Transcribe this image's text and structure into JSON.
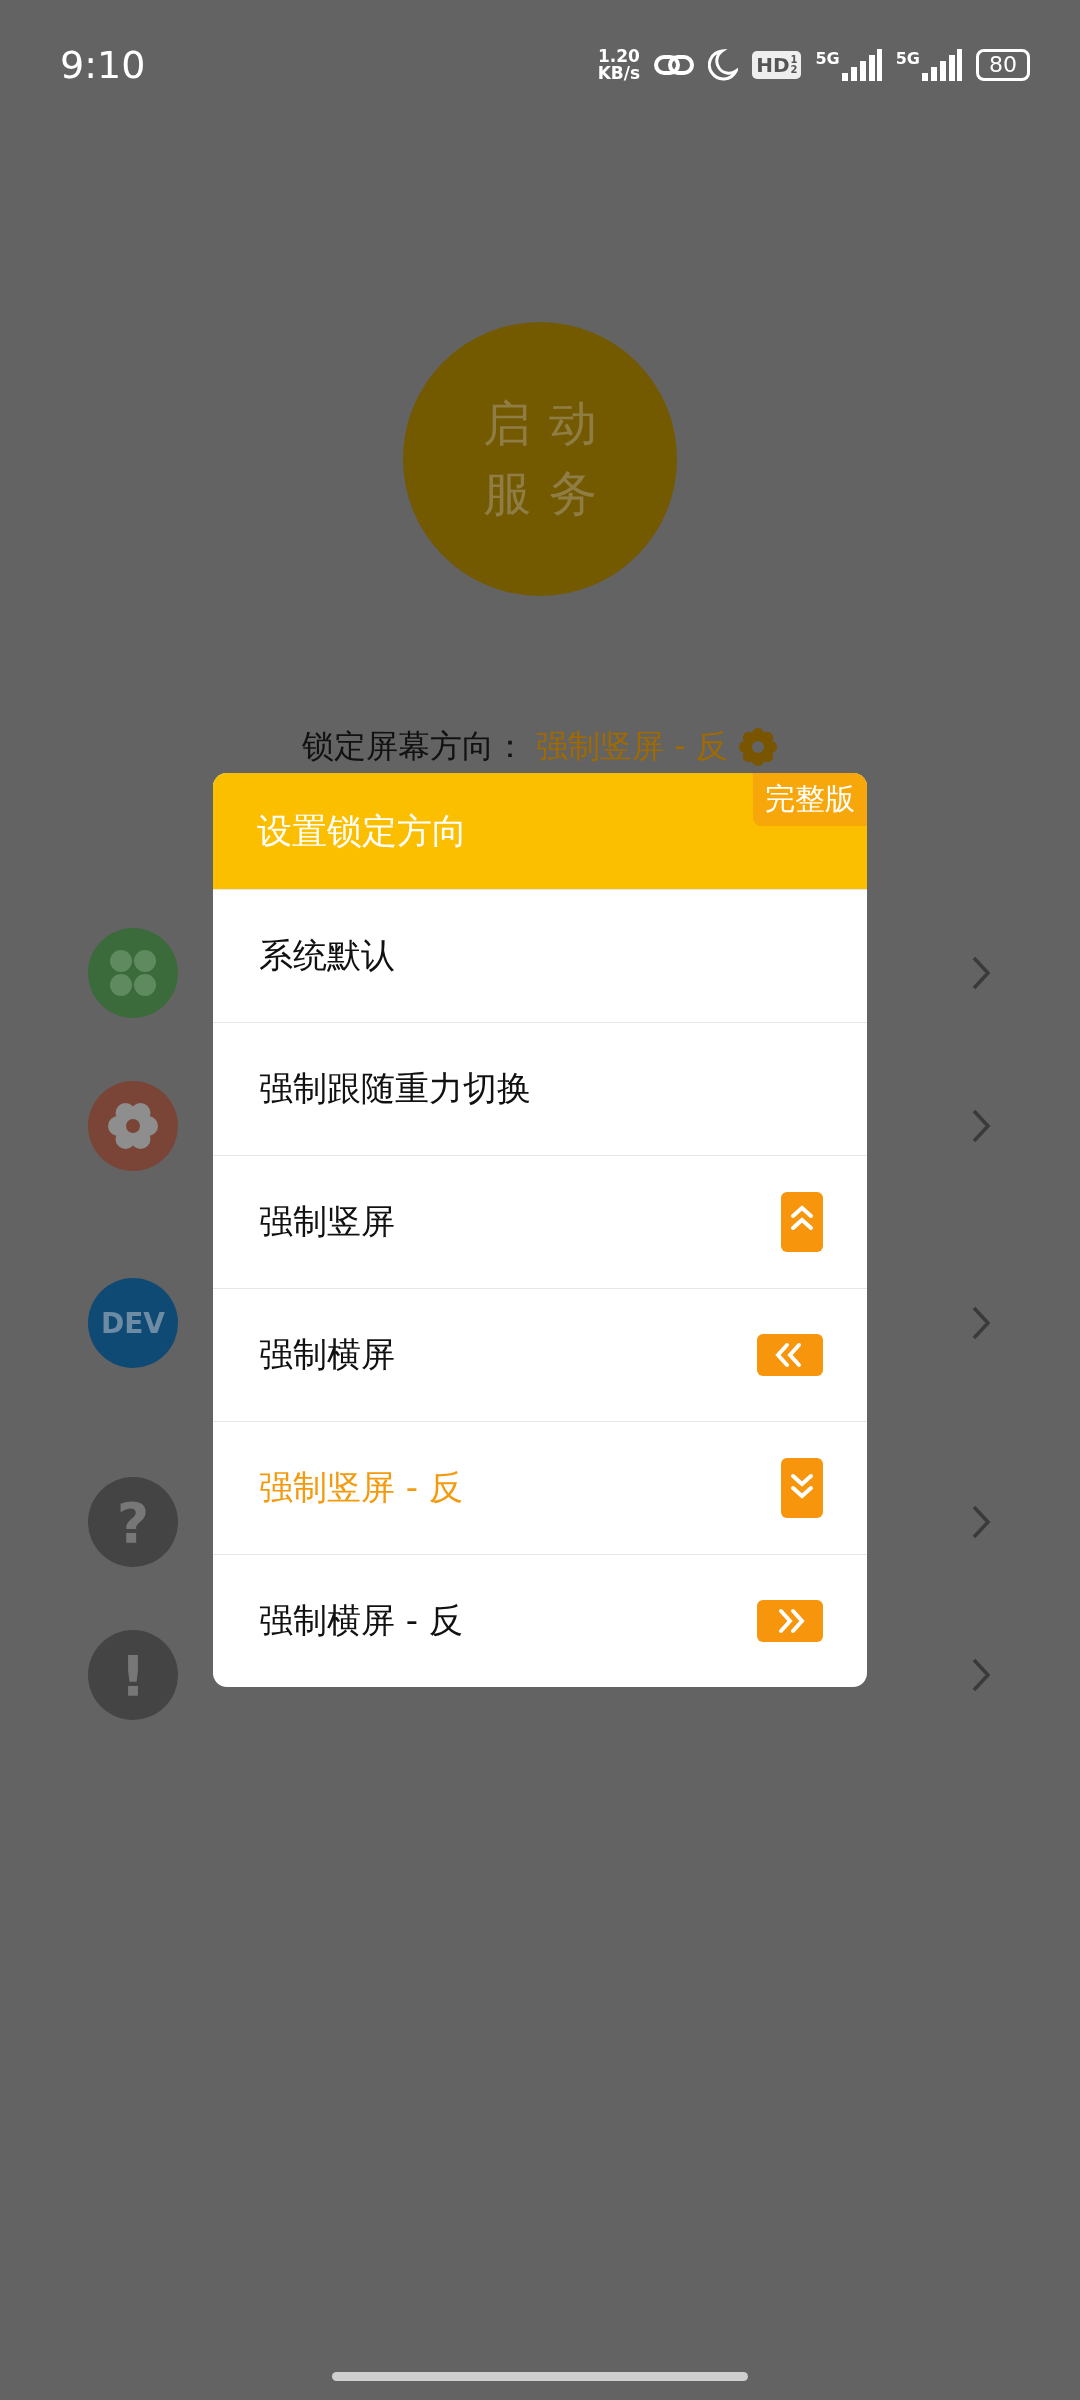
{
  "status_bar": {
    "time": "9:10",
    "net_speed": [
      "1.20",
      "KB/s"
    ],
    "hd": "HD",
    "hd_sim": [
      "1",
      "2"
    ],
    "signals": [
      "5G",
      "5G"
    ],
    "battery": "80"
  },
  "start_button": {
    "lines": [
      "启动",
      "服务"
    ]
  },
  "lock_orientation": {
    "label": "锁定屏幕方向：",
    "value": "强制竖屏 - 反"
  },
  "background_list": [
    {
      "kind": "apps"
    },
    {
      "kind": "flower"
    },
    {
      "kind": "dev",
      "icon_text": "DEV"
    },
    {
      "kind": "help",
      "icon_text": "?"
    },
    {
      "kind": "info",
      "icon_text": "!"
    }
  ],
  "dialog": {
    "title": "设置锁定方向",
    "badge": "完整版",
    "options": [
      {
        "label": "系统默认",
        "selected": false
      },
      {
        "label": "强制跟随重力切换",
        "selected": false
      },
      {
        "label": "强制竖屏",
        "selected": false,
        "kind": "up"
      },
      {
        "label": "强制横屏",
        "selected": false,
        "kind": "left"
      },
      {
        "label": "强制竖屏 - 反",
        "selected": true,
        "kind": "down"
      },
      {
        "label": "强制横屏 - 反",
        "selected": false,
        "kind": "right"
      }
    ]
  }
}
